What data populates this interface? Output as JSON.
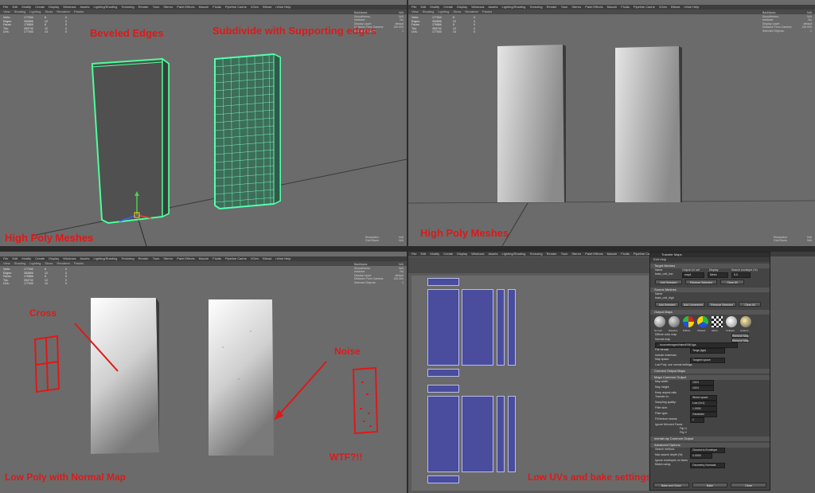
{
  "menu_items": [
    "File",
    "Edit",
    "Modify",
    "Create",
    "Display",
    "Windows",
    "Assets",
    "Lighting/Shading",
    "Texturing",
    "Render",
    "Toon",
    "Stereo",
    "Paint Effects",
    "Muscle",
    "Fluids",
    "Pipeline Cache",
    "XGen",
    "Bifrost",
    "nHair Help"
  ],
  "view_items": [
    "View",
    "Shading",
    "Lighting",
    "Show",
    "Renderer",
    "Panels"
  ],
  "hud_stats": [
    {
      "label": "Verts:",
      "v1": "177040",
      "v2": "8",
      "v3": "0"
    },
    {
      "label": "Edges:",
      "v1": "353896",
      "v2": "12",
      "v3": "0"
    },
    {
      "label": "Faces:",
      "v1": "176866",
      "v2": "6",
      "v3": "0"
    },
    {
      "label": "Tris:",
      "v1": "353732",
      "v2": "12",
      "v3": "0"
    },
    {
      "label": "UVs:",
      "v1": "177040",
      "v2": "14",
      "v3": "0"
    }
  ],
  "hud_right": [
    {
      "label": "Backfaces:",
      "value": "N/A"
    },
    {
      "label": "Smoothness:",
      "value": "N/A"
    },
    {
      "label": "Instance:",
      "value": "No"
    },
    {
      "label": "Display Layer:",
      "value": "default"
    },
    {
      "label": "Distance From Camera:",
      "value": "130.000"
    },
    {
      "label": "Selected Objects:",
      "value": "1"
    }
  ],
  "hud_bottom": [
    {
      "label": "Resolution:",
      "value": "N/A"
    },
    {
      "label": "Grid Rows:",
      "value": "N/A"
    }
  ],
  "annotations": {
    "beveled_edges": "Beveled Edges",
    "subdivide": "Subdivide with Supporting edges",
    "high_poly_1": "High Poly Meshes",
    "high_poly_2": "High Poly Meshes",
    "cross": "Cross",
    "noise": "Noise",
    "wtf": "WTF?!!",
    "low_poly": "Low Poly with Normal Map",
    "low_uvs": "Low UVs and bake settings"
  },
  "bake": {
    "title": "Transfer Maps",
    "menu": "Edit  Help",
    "target_meshes": "Target Meshes",
    "target_cols": [
      "Name",
      "Output UV set",
      "Display",
      "Search envelope (%)"
    ],
    "target_row": [
      "base_unit_low",
      "map1",
      "Mesh",
      "5.0"
    ],
    "add_selected": "Add Selected",
    "remove_selected": "Remove Selected",
    "clear_all": "Clear All",
    "source_meshes": "Source Meshes",
    "source_name_header": "Name",
    "source_row": "base_unit_high",
    "add_selected_2": "Add Selected",
    "add_unmeshed": "Add Unmeshed",
    "remove_selected_2": "Remove Selected",
    "clear_all_2": "Clear All",
    "output_maps": "Output Maps",
    "map_types": [
      "Normal",
      "Displace",
      "Diffuse",
      "Shaded",
      "Alpha",
      "Ambient",
      "Custom"
    ],
    "diffuse_color": "Diffuse color map",
    "remove_map": "Remove Map",
    "normal_map": "Normal map",
    "normal_map_path": ".../sourceimages/baked/NM.tga",
    "file_format_label": "File format:",
    "file_format": "Targa (tga)",
    "include_materials": "Include materials:",
    "map_space_label": "Map space:",
    "map_space": "Tangent space",
    "low_poly_mode": "Low Poly: use normal settings",
    "connect_output": "Connect Output Maps",
    "common_output": "Maya Common Output",
    "map_width_label": "Map width:",
    "map_width": "1024",
    "map_height_label": "Map height:",
    "map_height": "1024",
    "keep_aspect": "Keep aspect ratio",
    "transfer_in_label": "Transfer in:",
    "transfer_in": "World space",
    "sampling_label": "Sampling quality:",
    "sampling": "Low (1x1)",
    "filter_size_label": "Filter size:",
    "filter_size": "1.0000",
    "filter_type_label": "Filter type:",
    "filter_type": "Gaussian",
    "fill_texture_label": "Fill texture seams:",
    "fill_texture": "1",
    "ignore_mirrored": "Ignore Mirrored Faces",
    "flip_u": "Flip U",
    "flip_v": "Flip V",
    "mental_ray": "mental ray Common Output",
    "advanced": "Advanced Options",
    "search_method_label": "Search method:",
    "search_method": "Closest to Envelope",
    "max_search_label": "Max search depth (%):",
    "max_search": "0.0000",
    "ignore_envelopes": "Ignore envelopes on faces",
    "match_using_label": "Match using:",
    "match_using": "Geometry Normals",
    "bake_close": "Bake and Close",
    "bake_btn": "Bake",
    "close_btn": "Close"
  }
}
